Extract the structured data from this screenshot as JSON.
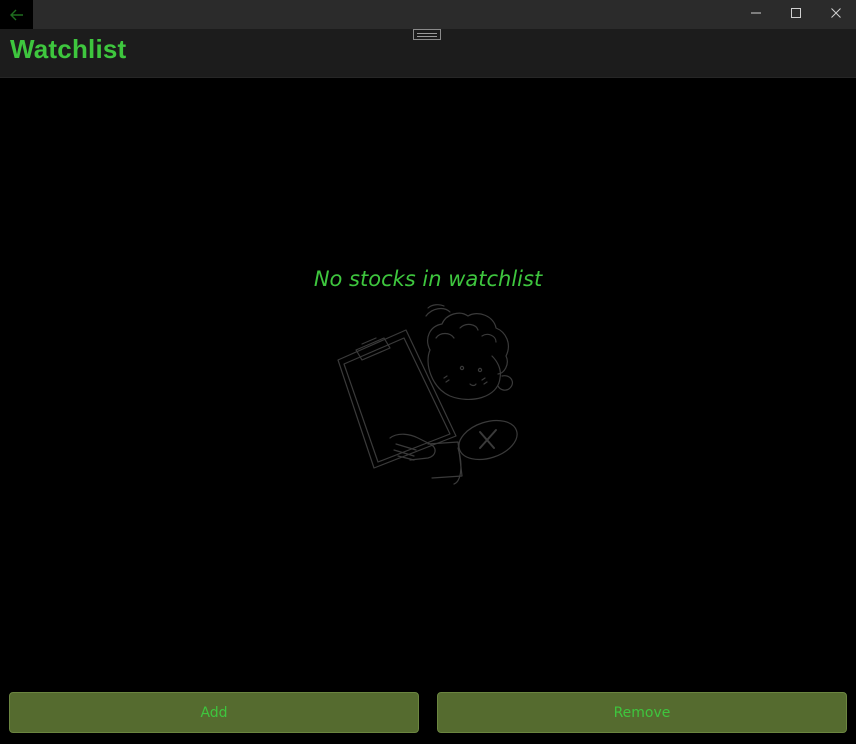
{
  "window": {
    "back_icon": "arrow-left-icon",
    "minimize_icon": "minimize-icon",
    "maximize_icon": "maximize-icon",
    "close_icon": "close-icon"
  },
  "header": {
    "title": "Watchlist"
  },
  "main": {
    "empty_message": "No stocks in watchlist",
    "illustration_icon": "person-clipboard-illustration"
  },
  "actions": {
    "add_label": "Add",
    "remove_label": "Remove"
  },
  "colors": {
    "accent": "#3ec63e",
    "button_bg": "#556b2f",
    "background": "#000000"
  }
}
